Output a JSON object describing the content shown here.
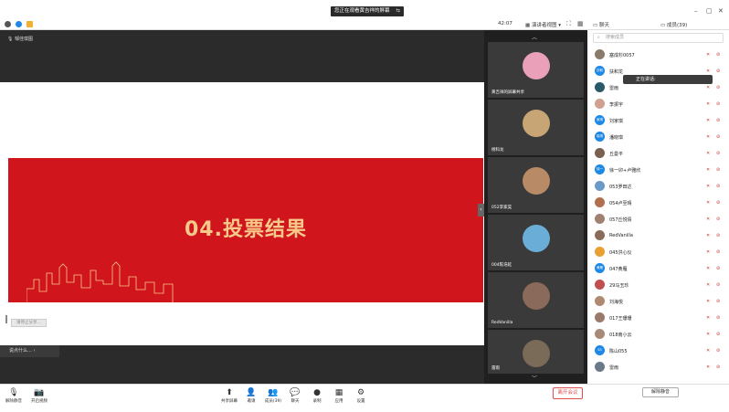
{
  "banner": {
    "text": "您正在观看黄吉祥的屏幕",
    "stop_label": "⇆"
  },
  "window_controls": [
    "–",
    "▢",
    "✕"
  ],
  "meeting_bar": {
    "timer": "42:07",
    "view_mode": "演讲者视图"
  },
  "panel_tabs": {
    "chat": "聊天",
    "members": "成员(39)"
  },
  "share": {
    "sharer_label": "邹佳琪图",
    "slide_title": "04.投票结果",
    "annotation_label": "请停止分享…",
    "subtitle_label": "说点什么…"
  },
  "gallery": {
    "tiles": [
      {
        "name": "黄吉祥的屏幕共享",
        "color": "#e9a0b8"
      },
      {
        "name": "杨科龙",
        "color": "#c8a574"
      },
      {
        "name": "052李家昊",
        "color": "#b88a66"
      },
      {
        "name": "004陈浩延",
        "color": "#6aaed8"
      },
      {
        "name": "RedVanilla",
        "color": "#8a6a5a"
      },
      {
        "name": "雷雨",
        "color": "#7a6a58"
      }
    ]
  },
  "participants": {
    "search_placeholder": "搜索成员",
    "speaking_label": "正在讲话:",
    "list": [
      {
        "name": "塞成杉0057",
        "avatar_text": "",
        "color": "#8a7a6a"
      },
      {
        "name": "扶和龙",
        "avatar_text": "扶和",
        "color": "#1e88e5"
      },
      {
        "name": "雷雨",
        "avatar_text": "",
        "color": "#2a5a6a"
      },
      {
        "name": "李振宇",
        "avatar_text": "",
        "color": "#d0a090"
      },
      {
        "name": "刘家琪",
        "avatar_text": "家琪",
        "color": "#1e88e5"
      },
      {
        "name": "潘晓琪",
        "avatar_text": "晓琪",
        "color": "#1e88e5"
      },
      {
        "name": "丘曼平",
        "avatar_text": "",
        "color": "#7a6050"
      },
      {
        "name": "徐一卯+卢雅欣",
        "avatar_text": "徐一",
        "color": "#1e88e5"
      },
      {
        "name": "053罗田达",
        "avatar_text": "",
        "color": "#6a9ac8"
      },
      {
        "name": "054卢至晴",
        "avatar_text": "",
        "color": "#b07050"
      },
      {
        "name": "057丘悦倩",
        "avatar_text": "",
        "color": "#a08070"
      },
      {
        "name": "RedVanilla",
        "avatar_text": "",
        "color": "#8a6a5a"
      },
      {
        "name": "045洪心仪",
        "avatar_text": "",
        "color": "#e8a030"
      },
      {
        "name": "047黄雁",
        "avatar_text": "黄雁",
        "color": "#1e88e5"
      },
      {
        "name": "29马玉珍",
        "avatar_text": "",
        "color": "#c05050"
      },
      {
        "name": "刘海悦",
        "avatar_text": "",
        "color": "#b08a70"
      },
      {
        "name": "017王珊珊",
        "avatar_text": "",
        "color": "#9a7a6a"
      },
      {
        "name": "018南小云",
        "avatar_text": "",
        "color": "#a88a78"
      },
      {
        "name": "陈山055",
        "avatar_text": "SS",
        "color": "#1e88e5"
      },
      {
        "name": "雷雨",
        "avatar_text": "",
        "color": "#6a7a8a"
      }
    ]
  },
  "toolbar": {
    "left": [
      {
        "label": "解除静音",
        "icon": "microphone-muted-icon"
      },
      {
        "label": "开启视频",
        "icon": "camera-off-icon"
      }
    ],
    "center": [
      {
        "label": "共享屏幕",
        "icon": "screen-share-icon"
      },
      {
        "label": "邀请",
        "icon": "invite-icon"
      },
      {
        "label": "成员(39)",
        "icon": "members-icon"
      },
      {
        "label": "聊天",
        "icon": "chat-icon"
      },
      {
        "label": "录制",
        "icon": "record-icon"
      },
      {
        "label": "应用",
        "icon": "apps-icon"
      },
      {
        "label": "设置",
        "icon": "settings-icon"
      }
    ],
    "leave_label": "离开会议",
    "unmute_all_label": "解除静音"
  }
}
